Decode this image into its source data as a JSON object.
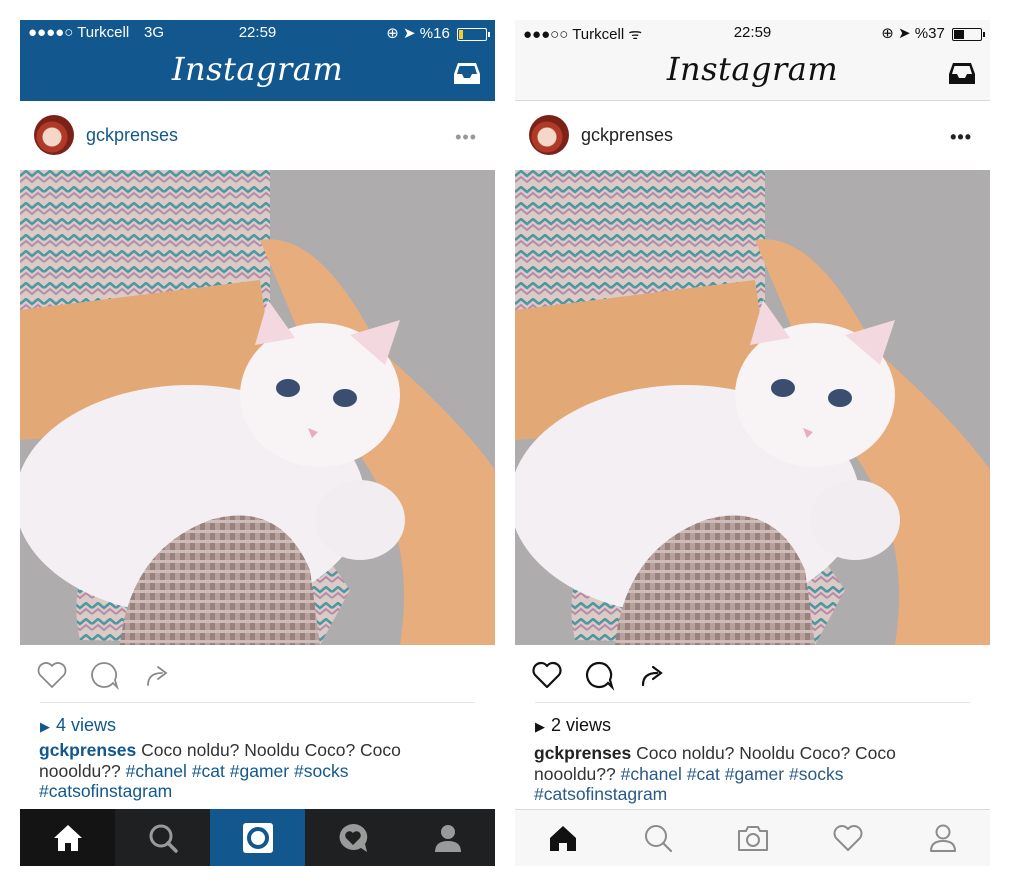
{
  "left": {
    "status": {
      "carrier": "●●●●○ Turkcell",
      "network": "3G",
      "time": "22:59",
      "battery": "%16",
      "battery_level": 0.16
    },
    "app_title": "Instagram",
    "post": {
      "username": "gckprenses",
      "views": "4 views",
      "caption_user": "gckprenses",
      "caption_text": " Coco noldu? Nooldu Coco? Coco noooldu??",
      "hashtags": [
        "#chanel",
        "#cat",
        "#gamer",
        "#socks",
        "#catsofinstagram"
      ]
    },
    "icons": {
      "more": "•••"
    }
  },
  "right": {
    "status": {
      "carrier": "●●●○○ Turkcell",
      "time": "22:59",
      "battery": "%37",
      "battery_level": 0.37
    },
    "app_title": "Instagram",
    "post": {
      "username": "gckprenses",
      "views": "2 views",
      "caption_user": "gckprenses",
      "caption_text": " Coco noldu? Nooldu Coco? Coco noooldu??",
      "hashtags": [
        "#chanel",
        "#cat",
        "#gamer",
        "#socks",
        "#catsofinstagram"
      ]
    },
    "icons": {
      "more": "•••"
    }
  },
  "colors": {
    "brand_blue": "#12578d",
    "dark_tabbar": "#1f2021",
    "light_bar": "#f7f7f7"
  }
}
